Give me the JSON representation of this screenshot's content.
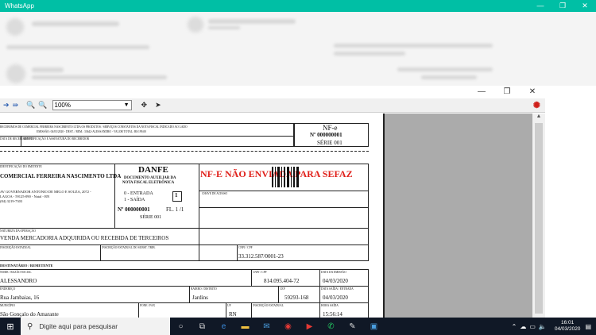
{
  "titlebar": {
    "title": "WhatsApp",
    "minimize": "—",
    "maximize": "❐",
    "close": "✕"
  },
  "viewer": {
    "window": {
      "minimize": "—",
      "maximize": "❐",
      "close": "✕"
    },
    "zoom": "100%"
  },
  "danfe": {
    "receipt_line1": "RECEBEMOS DE COMERCIAL FERREIRA NASCIMENTO LTDA OS PRODUTOS / SERVIÇOS CONSTANTES DA NOTA FISCAL INDICADO AO LADO",
    "receipt_line2": "EMISSÃO: 04/03/2020 - DEST. / REM.: 33642-ALESSANDRO - VALOR TOTAL: R$ 199,00",
    "receipt_date_lbl": "DATA DE RECEBIMENTO",
    "receipt_sign_lbl": "IDENTIFICAÇÃO E ASSINATURA DO RECEBEDOR",
    "nfe_title": "NF-e",
    "nfe_number": "Nº 000000001",
    "nfe_series": "SÉRIE 001",
    "emitente_lbl": "IDENTIFICAÇÃO DO EMITENTE",
    "emitente_name": "COMERCIAL FERREIRA NASCIMENTO LTDA",
    "emitente_addr1": "AV GOVERNADOR ANTONIO DE MELO E SOUZA, 2072 -",
    "emitente_addr2": "LAGOA - 59125-090 - Natal - RN",
    "emitente_phone": "(84) 3219-7303",
    "danfe_title": "DANFE",
    "danfe_sub1": "DOCUMENTO AUXILIAR DA",
    "danfe_sub2": "NOTA FISCAL ELETRÔNICA",
    "entrada": "0 - ENTRADA",
    "saida": "1 - SAÍDA",
    "tipo": "1",
    "number": "Nº 000000001",
    "folha": "FL. 1 /1",
    "series": "SÉRIE 001",
    "warning": "NF-E NÃO ENVIADA PARA SEFAZ",
    "chave_lbl": "CHAVE DE ACESSO",
    "natureza_lbl": "NATUREZA DA OPERAÇÃO",
    "natureza": "VENDA MERCADORIA ADQUIRIDA OU RECEBIDA DE TERCEIROS",
    "ie_lbl": "INSCRIÇÃO ESTADUAL",
    "iest_lbl": "INSCRIÇÃO ESTADUAL DO SUBST. TRIB.",
    "cnpj_lbl": "CNPJ / CPF",
    "cnpj": "33.312.587/0001-23",
    "dest_section": "DESTINATÁRIO / REMETENTE",
    "razao_lbl": "NOME / RAZÃO SOCIAL",
    "razao": "ALESSANDRO",
    "cpf_lbl": "CNPJ / CPF",
    "cpf": "814.095.404-72",
    "emissao_lbl": "DATA DA EMISSÃO",
    "emissao": "04/03/2020",
    "endereco_lbl": "ENDEREÇO",
    "endereco": "Rua Jambaias, 16",
    "bairro_lbl": "BAIRRO / DISTRITO",
    "bairro": "Jardins",
    "cep_lbl": "CEP",
    "cep": "59293-168",
    "saida_data_lbl": "DATA SAÍDA / ENTRADA",
    "saida_data": "04/03/2020",
    "municipio_lbl": "MUNICÍPIO",
    "municipio": "São Gonçalo do Amarante",
    "fone_lbl": "FONE / FAX",
    "uf_lbl": "UF",
    "uf": "RN",
    "dest_ie_lbl": "INSCRIÇÃO ESTADUAL",
    "hora_lbl": "HORA SAÍDA",
    "hora": "15:56:14"
  },
  "taskbar": {
    "search_placeholder": "Digite aqui para pesquisar",
    "time": "16:01",
    "date": "04/03/2020"
  }
}
